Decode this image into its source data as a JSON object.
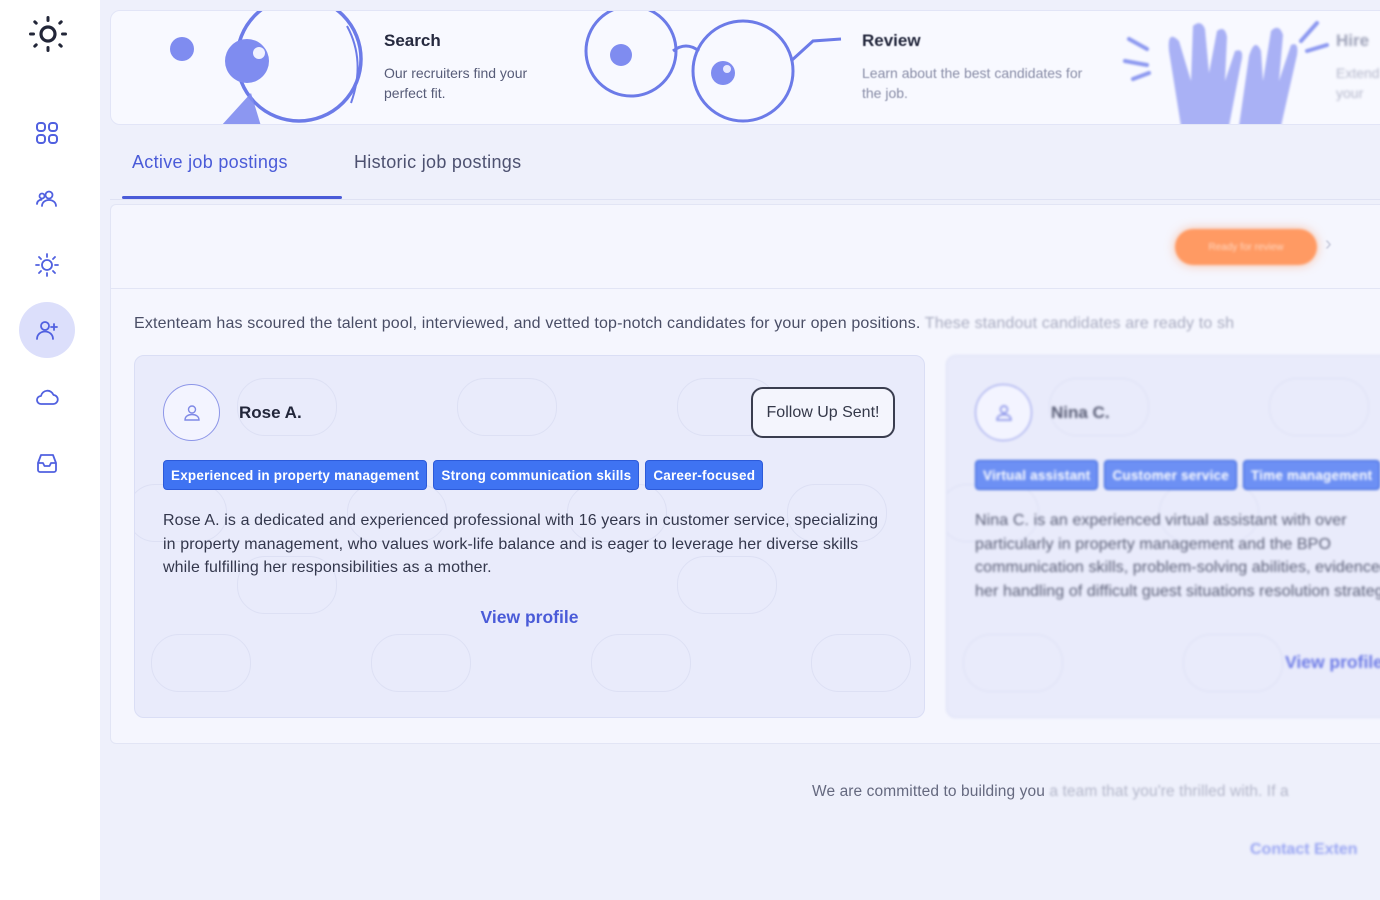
{
  "colors": {
    "accent": "#4a5bd8",
    "tag": "#3f73f2",
    "status": "#ff9a63",
    "illustration": "#6c7be8"
  },
  "sidebar": {
    "items": [
      {
        "name": "grid-icon"
      },
      {
        "name": "team-icon"
      },
      {
        "name": "sun-icon"
      },
      {
        "name": "add-user-icon",
        "active": true
      },
      {
        "name": "cloud-icon"
      },
      {
        "name": "inbox-icon"
      }
    ]
  },
  "banner": {
    "steps": [
      {
        "title": "Search",
        "desc": "Our recruiters find your perfect fit.",
        "icon": "magnifier-illustration"
      },
      {
        "title": "Review",
        "desc": "Learn about the best candidates for the job.",
        "icon": "glasses-illustration"
      },
      {
        "title": "Hire",
        "desc": "Extend your",
        "icon": "hands-illustration"
      }
    ]
  },
  "tabs": [
    {
      "label": "Active job postings",
      "active": true
    },
    {
      "label": "Historic job postings",
      "active": false
    }
  ],
  "posting": {
    "status_label": "Ready for review",
    "intro_visible": "Extenteam has scoured the talent pool, interviewed, and vetted top-notch candidates for your open positions.",
    "intro_faded": "These standout candidates are ready to sh"
  },
  "candidates": [
    {
      "name": "Rose A.",
      "follow_up": "Follow Up Sent!",
      "tags": [
        "Experienced in property management",
        "Strong communication skills",
        "Career-focused"
      ],
      "description": "Rose A. is a dedicated and experienced professional with 16 years in customer service, specializing in property management, who values work-life balance and is eager to leverage her diverse skills while fulfilling her responsibilities as a mother.",
      "view_profile": "View profile"
    },
    {
      "name": "Nina C.",
      "tags": [
        "Virtual assistant",
        "Customer service",
        "Time management"
      ],
      "description": "Nina C. is an experienced virtual assistant with over particularly in property management and the BPO communication skills, problem-solving abilities, evidenced by her handling of difficult guest situations resolution strategies.",
      "view_profile": "View profile"
    }
  ],
  "footer": {
    "note_visible": "We are committed to building you",
    "note_faded": "a team that you're thrilled with. If a",
    "contact_link": "Contact Exten"
  }
}
